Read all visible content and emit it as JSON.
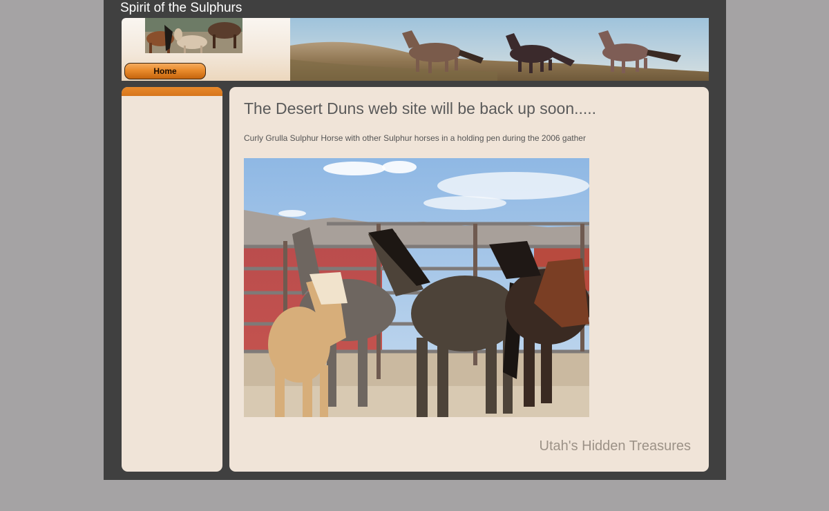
{
  "site": {
    "title": "Spirit of the Sulphurs"
  },
  "nav": {
    "home_label": "Home"
  },
  "main": {
    "heading": "The Desert Duns web site will be back up soon.....",
    "caption": "Curly Grulla Sulphur Horse with other Sulphur horses in a holding pen during the 2006 gather",
    "tagline": "Utah's Hidden Treasures"
  },
  "colors": {
    "page_background": "#a5a3a4",
    "frame": "#404040",
    "panel": "#f0e4d8",
    "accent_orange": "#e8892b",
    "heading_text": "#5a5a5a",
    "tagline_text": "#9c9287"
  },
  "images": {
    "header_thumbnail": "horses-thumbnail",
    "header_banner": "running-horses-banner",
    "main_photo": "horses-in-holding-pen-photo"
  }
}
